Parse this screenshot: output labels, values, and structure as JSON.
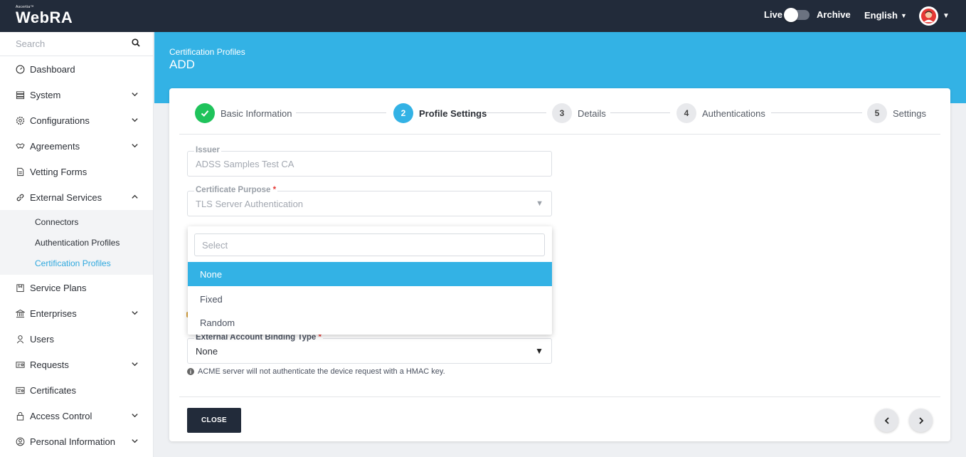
{
  "header": {
    "brand_small": "Ascertia™",
    "brand": "WebRA",
    "live_label": "Live",
    "archive_label": "Archive",
    "language": "English"
  },
  "sidebar": {
    "search_placeholder": "Search",
    "items": [
      {
        "label": "Dashboard",
        "icon": "dashboard-icon",
        "expandable": false
      },
      {
        "label": "System",
        "icon": "system-icon",
        "expandable": true
      },
      {
        "label": "Configurations",
        "icon": "gear-icon",
        "expandable": true
      },
      {
        "label": "Agreements",
        "icon": "handshake-icon",
        "expandable": true
      },
      {
        "label": "Vetting Forms",
        "icon": "document-icon",
        "expandable": false
      },
      {
        "label": "External Services",
        "icon": "link-icon",
        "expandable": true,
        "expanded": true
      },
      {
        "label": "Service Plans",
        "icon": "service-plan-icon",
        "expandable": false
      },
      {
        "label": "Enterprises",
        "icon": "bank-icon",
        "expandable": true
      },
      {
        "label": "Users",
        "icon": "user-icon",
        "expandable": false
      },
      {
        "label": "Requests",
        "icon": "request-icon",
        "expandable": true
      },
      {
        "label": "Certificates",
        "icon": "certificate-icon",
        "expandable": false
      },
      {
        "label": "Access Control",
        "icon": "lock-icon",
        "expandable": true
      },
      {
        "label": "Personal Information",
        "icon": "person-circle-icon",
        "expandable": true
      }
    ],
    "external_services_children": [
      "Connectors",
      "Authentication Profiles",
      "Certification Profiles"
    ]
  },
  "banner": {
    "breadcrumb": "Certification Profiles",
    "title": "ADD"
  },
  "stepper": {
    "steps": [
      {
        "number": "1",
        "label": "Basic Information",
        "state": "done"
      },
      {
        "number": "2",
        "label": "Profile Settings",
        "state": "active"
      },
      {
        "number": "3",
        "label": "Details",
        "state": "pending"
      },
      {
        "number": "4",
        "label": "Authentications",
        "state": "pending"
      },
      {
        "number": "5",
        "label": "Settings",
        "state": "pending"
      }
    ]
  },
  "form": {
    "issuer_label": "Issuer",
    "issuer_value": "ADSS Samples Test CA",
    "purpose_label": "Certificate Purpose",
    "purpose_value": "TLS Server Authentication",
    "eab_label": "External Account Binding Type",
    "eab_value": "None",
    "eab_hint": "ACME server will not authenticate the device request with a HMAC key.",
    "required_mark": "*"
  },
  "dropdown": {
    "search_placeholder": "Select",
    "options": [
      "None",
      "Fixed",
      "Random"
    ],
    "selected": "None"
  },
  "actions": {
    "close_label": "CLOSE"
  },
  "colors": {
    "topbar": "#222b3a",
    "accent": "#33b2e5",
    "success": "#1fc35b",
    "required": "#e53935"
  }
}
